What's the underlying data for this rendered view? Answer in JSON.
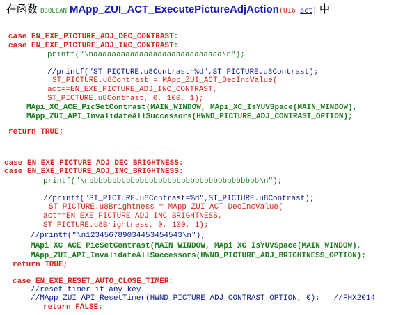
{
  "title": {
    "prefix": "在函数",
    "keyword": "BOOLEAN",
    "function": "MApp_ZUI_ACT_ExecutePictureAdjAction",
    "arg_open": "(U16 ",
    "arg_name": "act",
    "arg_close": ")",
    "suffix": "中"
  },
  "code_lines": [
    {
      "text": "case EN_EXE_PICTURE_ADJ_DEC_CONTRAST:",
      "style": "case"
    },
    {
      "text": "case EN_EXE_PICTURE_ADJ_INC_CONTRAST:",
      "style": "case"
    },
    {
      "text": "printf(\"\\naaaaaaaaaaaaaaaaaaaaaaaaaaaa\\n\");",
      "style": "call"
    },
    {
      "text": "//printf(\"ST_PICTURE.u8Contrast=%d\",ST_PICTURE.u8Contrast);",
      "style": "cmt"
    },
    {
      "text": "ST_PICTURE.u8Contrast = MApp_ZUI_ACT_DecIncValue(",
      "style": "red"
    },
    {
      "text": "act==EN_EXE_PICTURE_ADJ_INC_CONTRAST,",
      "style": "red"
    },
    {
      "text": "ST_PICTURE.u8Contrast, 0, 100, 1);",
      "style": "red"
    },
    {
      "text": "MApi_XC_ACE_PicSetContrast(MAIN_WINDOW, MApi_XC_IsYUVSpace(MAIN_WINDOW),",
      "style": "callb"
    },
    {
      "text": "MApp_ZUI_API_InvalidateAllSuccessors(HWND_PICTURE_ADJ_CONTRAST_OPTION);",
      "style": "callb"
    },
    {
      "text": "return TRUE;",
      "style": "ret"
    },
    {
      "text": "case EN_EXE_PICTURE_ADJ_DEC_BRIGHTNESS:",
      "style": "case"
    },
    {
      "text": "case EN_EXE_PICTURE_ADJ_INC_BRIGHTNESS:",
      "style": "case"
    },
    {
      "text": "printf(\"\\nbbbbbbbbbbbbbbbbbbbbbbbbbbbbbbbbbbbbb\\n\");",
      "style": "call"
    },
    {
      "text": "//printf(\"ST_PICTURE.u8Contrast=%d\",ST_PICTURE.u8Contrast);",
      "style": "cmt"
    },
    {
      "text": "ST_PICTURE.u8Brightness = MApp_ZUI_ACT_DecIncValue(",
      "style": "red"
    },
    {
      "text": "act==EN_EXE_PICTURE_ADJ_INC_BRIGHTNESS,",
      "style": "red"
    },
    {
      "text": "ST_PICTURE.u8Brightness, 0, 100, 1);",
      "style": "red"
    },
    {
      "text": "//printf(\"\\n123456789034453454543\\n\");",
      "style": "cmt"
    },
    {
      "text": "MApi_XC_ACE_PicSetContrast(MAIN_WINDOW, MApi_XC_IsYUVSpace(MAIN_WINDOW),",
      "style": "callb"
    },
    {
      "text": "MApp_ZUI_API_InvalidateAllSuccessors(HWND_PICTURE_ADJ_BRIGHTNESS_OPTION);",
      "style": "callb"
    },
    {
      "text": "return TRUE;",
      "style": "ret"
    },
    {
      "text": "case EN_EXE_RESET_AUTO_CLOSE_TIMER:",
      "style": "case"
    },
    {
      "text": "//reset timer if any key",
      "style": "cmt"
    },
    {
      "text": "//MApp_ZUI_API_ResetTimer(HWND_PICTURE_ADJ_CONTRAST_OPTION, 0);   //FHX2014",
      "style": "cmt"
    },
    {
      "text": "return FALSE;",
      "style": "ret"
    }
  ]
}
